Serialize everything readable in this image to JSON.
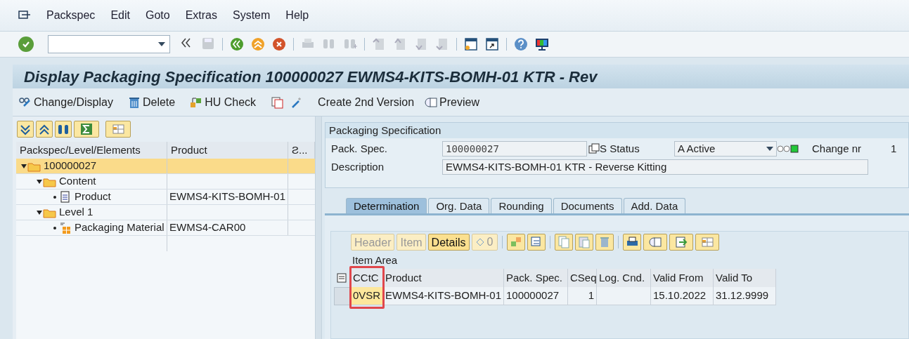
{
  "menu": [
    "Packspec",
    "Edit",
    "Goto",
    "Extras",
    "System",
    "Help"
  ],
  "title": "Display Packaging Specification 100000027 EWMS4-KITS-BOMH-01 KTR - Rev",
  "actions": [
    "Change/Display",
    "Delete",
    "HU Check",
    "Create 2nd Version",
    "Preview"
  ],
  "tree": {
    "columns": [
      "Packspec/Level/Elements",
      "Product",
      "Ƨ..."
    ],
    "nodes": [
      {
        "kind": "folder",
        "label": "100000027",
        "selected": true,
        "expanded": true,
        "children": [
          {
            "kind": "folder",
            "label": "Content",
            "selected": false,
            "expanded": true,
            "children": [
              {
                "kind": "document",
                "label": "Product",
                "product": "EWMS4-KITS-BOMH-01",
                "selected": false
              }
            ]
          },
          {
            "kind": "folder",
            "label": "Level 1",
            "selected": false,
            "expanded": true,
            "children": [
              {
                "kind": "packaging",
                "label": "Packaging Material",
                "product": "EWMS4-CAR00",
                "selected": false
              }
            ]
          }
        ]
      }
    ]
  },
  "header": {
    "title": "Packaging Specification",
    "pack_spec": {
      "label": "Pack. Spec.",
      "value": "100000027"
    },
    "status": {
      "label": "S Status",
      "value": "A Active"
    },
    "change_nr": {
      "label": "Change nr",
      "value": "1"
    },
    "description": {
      "label": "Description",
      "value": "EWMS4-KITS-BOMH-01 KTR - Reverse Kitting"
    }
  },
  "tabs": [
    {
      "label": "Determination",
      "selected": true
    },
    {
      "label": "Org. Data",
      "selected": false
    },
    {
      "label": "Rounding",
      "selected": false
    },
    {
      "label": "Documents",
      "selected": false
    },
    {
      "label": "Add. Data",
      "selected": false
    }
  ],
  "item_buttons": [
    {
      "label": "Header",
      "disabled": true
    },
    {
      "label": "Item",
      "disabled": true
    },
    {
      "label": "Details",
      "disabled": false
    }
  ],
  "counter": "0",
  "item_area": {
    "title": "Item Area",
    "columns": [
      "CCtC",
      "Product",
      "Pack. Spec.",
      "CSeq",
      "Log. Cnd.",
      "Valid From",
      "Valid To"
    ],
    "rows": [
      {
        "selected": false,
        "cells": [
          {
            "text": "0VSR",
            "focused": true
          },
          {
            "text": "EWMS4-KITS-BOMH-01",
            "focused": false
          },
          {
            "text": "100000027",
            "focused": false
          },
          {
            "text": "1",
            "focused": false
          },
          {
            "text": "",
            "focused": false
          },
          {
            "text": "15.10.2022",
            "focused": false
          },
          {
            "text": "31.12.9999",
            "focused": false
          }
        ]
      }
    ]
  }
}
